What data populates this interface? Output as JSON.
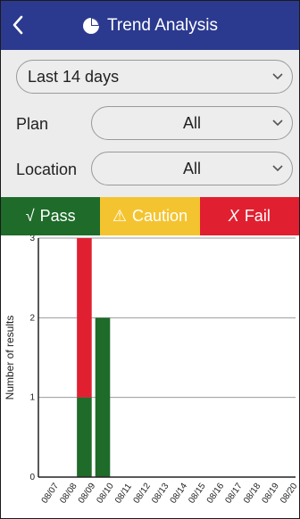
{
  "header": {
    "title": "Trend Analysis",
    "back_icon": "chevron-left-icon",
    "title_icon": "pie-chart-icon",
    "bg_color": "#2b3a8f"
  },
  "filters": {
    "period": "Last 14 days",
    "plan_label": "Plan",
    "plan_value": "All",
    "location_label": "Location",
    "location_value": "All"
  },
  "status": {
    "pass_label": "Pass",
    "pass_glyph": "√",
    "pass_color": "#1e6b2a",
    "caution_label": "Caution",
    "caution_glyph": "⚠",
    "caution_color": "#f4c430",
    "fail_label": "Fail",
    "fail_glyph": "X",
    "fail_color": "#e02030"
  },
  "chart_data": {
    "type": "bar",
    "stacked": true,
    "ylabel": "Number of results",
    "xlabel": "",
    "ylim": [
      0,
      3
    ],
    "yticks": [
      0,
      1,
      2,
      3
    ],
    "grid": true,
    "categories": [
      "08/07",
      "08/08",
      "08/09",
      "08/10",
      "08/11",
      "08/12",
      "08/13",
      "08/14",
      "08/15",
      "08/16",
      "08/17",
      "08/18",
      "08/19",
      "08/20"
    ],
    "series": [
      {
        "key": "pass",
        "color": "#1e6b2a",
        "values": [
          0,
          0,
          1,
          2,
          0,
          0,
          0,
          0,
          0,
          0,
          0,
          0,
          0,
          0
        ]
      },
      {
        "key": "fail",
        "color": "#e02030",
        "values": [
          0,
          0,
          2,
          0,
          0,
          0,
          0,
          0,
          0,
          0,
          0,
          0,
          0,
          0
        ]
      }
    ]
  }
}
